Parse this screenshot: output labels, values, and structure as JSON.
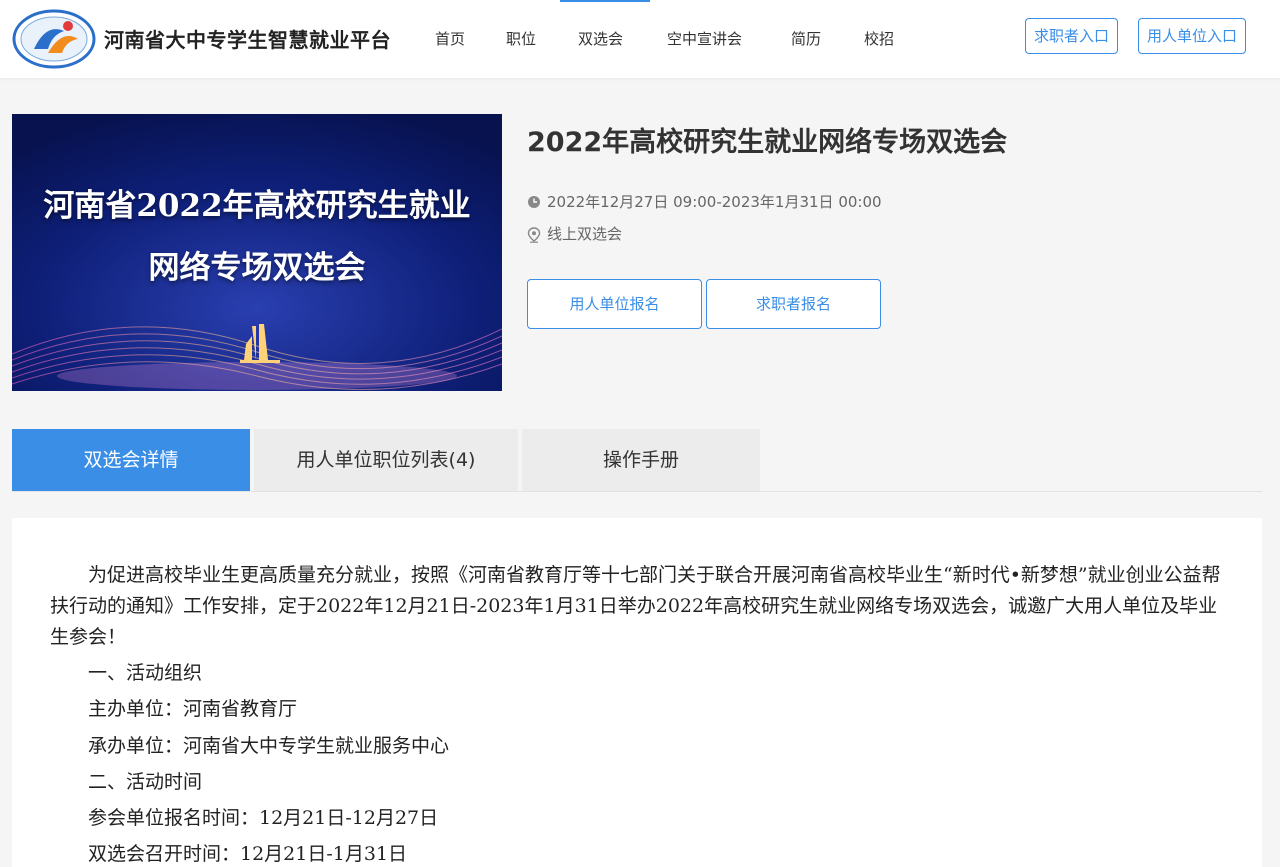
{
  "site": {
    "title": "河南省大中专学生智慧就业平台"
  },
  "nav": {
    "items": [
      "首页",
      "职位",
      "双选会",
      "空中宣讲会",
      "简历",
      "校招"
    ],
    "active": "双选会"
  },
  "header_buttons": {
    "seeker": "求职者入口",
    "employer": "用人单位入口"
  },
  "banner": {
    "line1": "河南省2022年高校研究生就业",
    "line2": "网络专场双选会"
  },
  "event": {
    "title": "2022年高校研究生就业网络专场双选会",
    "time": "2022年12月27日 09:00-2023年1月31日 00:00",
    "location": "线上双选会",
    "employer_register": "用人单位报名",
    "seeker_register": "求职者报名"
  },
  "tabs": [
    "双选会详情",
    "用人单位职位列表(4)",
    "操作手册"
  ],
  "detail": {
    "intro": "为促进高校毕业生更高质量充分就业，按照《河南省教育厅等十七部门关于联合开展河南省高校毕业生“新时代•新梦想”就业创业公益帮扶行动的通知》工作安排，定于2022年12月21日-2023年1月31日举办2022年高校研究生就业网络专场双选会，诚邀广大用人单位及毕业生参会！",
    "lines": [
      "一、活动组织",
      "主办单位：河南省教育厅",
      "承办单位：河南省大中专学生就业服务中心",
      "二、活动时间",
      "参会单位报名时间：12月21日-12月27日",
      "双选会召开时间：12月21日-1月31日"
    ]
  },
  "colors": {
    "accent": "#3a8ee6",
    "banner_bg": "#0a1a6e"
  }
}
